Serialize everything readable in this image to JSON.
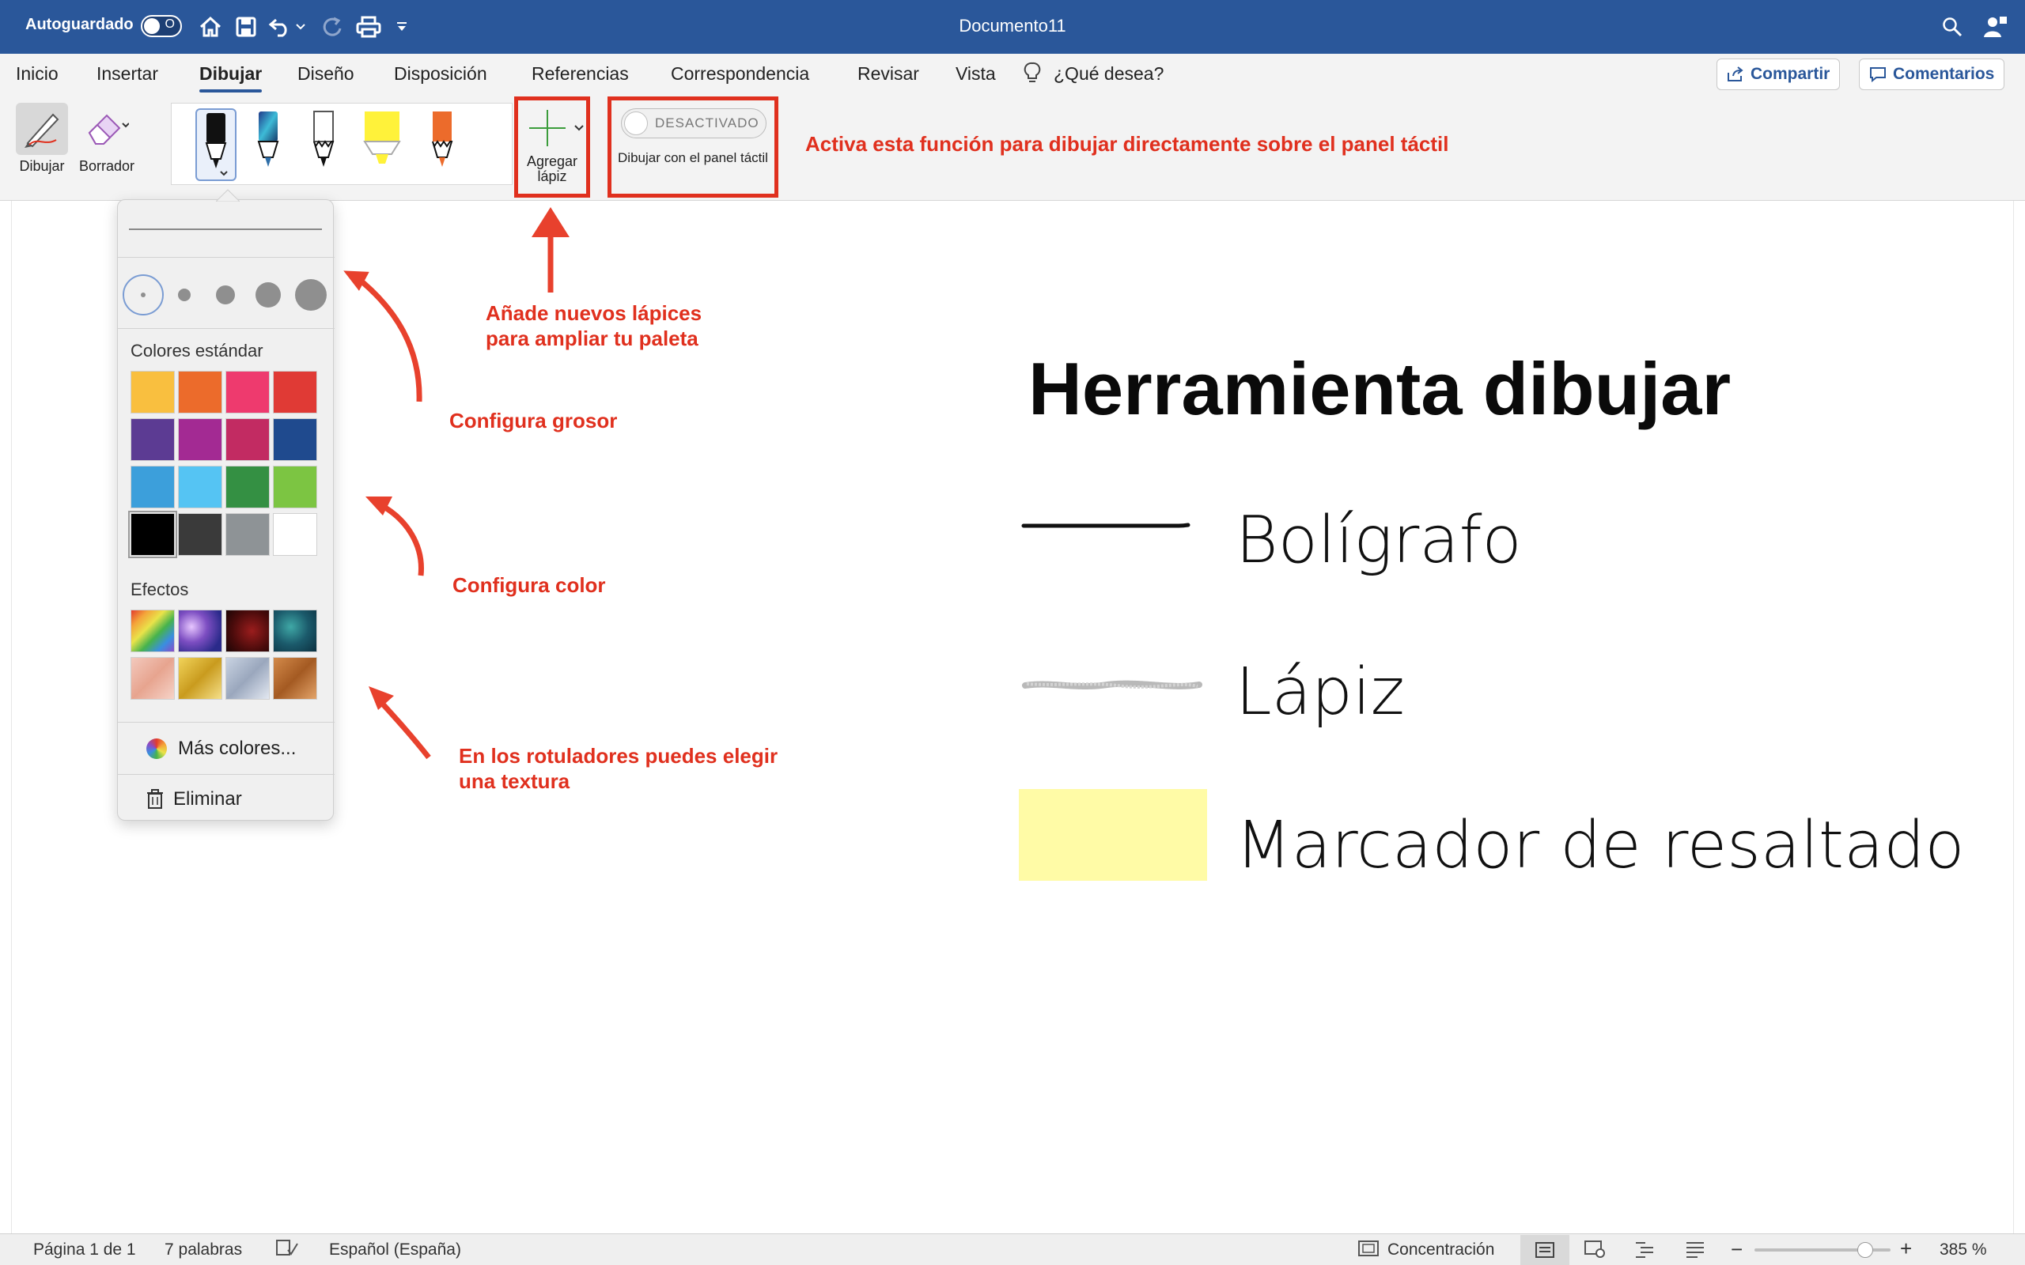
{
  "titlebar": {
    "autosave_label": "Autoguardado",
    "autosave_state": "O",
    "document_title": "Documento11"
  },
  "tabs": [
    {
      "label": "Inicio"
    },
    {
      "label": "Insertar"
    },
    {
      "label": "Dibujar",
      "active": true
    },
    {
      "label": "Diseño"
    },
    {
      "label": "Disposición"
    },
    {
      "label": "Referencias"
    },
    {
      "label": "Correspondencia"
    },
    {
      "label": "Revisar"
    },
    {
      "label": "Vista"
    },
    {
      "label": "¿Qué desea?"
    }
  ],
  "share_label": "Compartir",
  "comments_label": "Comentarios",
  "ribbon": {
    "draw_label": "Dibujar",
    "eraser_label": "Borrador",
    "add_pen_label": "Agregar lápiz",
    "trackpad_switch": "DESACTIVADO",
    "trackpad_label": "Dibujar con el panel táctil"
  },
  "annotations": {
    "trackpad": "Activa esta función para dibujar directamente sobre el panel táctil",
    "add_pen_line1": "Añade nuevos lápices",
    "add_pen_line2": "para ampliar tu paleta",
    "thickness": "Configura grosor",
    "color": "Configura color",
    "texture_line1": "En los rotuladores puedes elegir",
    "texture_line2": "una textura"
  },
  "palette": {
    "standard_colors_title": "Colores estándar",
    "standard_colors": [
      "#f9bf3f",
      "#ec6b2b",
      "#ee3a6e",
      "#e03a35",
      "#5c3b93",
      "#a32a93",
      "#c22b62",
      "#1f4a8e",
      "#3c9fdb",
      "#55c4f3",
      "#349043",
      "#7cc542",
      "#000000",
      "#3a3a3a",
      "#8e9396",
      "#ffffff"
    ],
    "effects_title": "Efectos",
    "effects": [
      "rainbow",
      "galaxy",
      "lava",
      "ocean",
      "rose-gold",
      "gold",
      "silver",
      "bronze"
    ],
    "more_colors": "Más colores...",
    "delete": "Eliminar"
  },
  "document": {
    "title": "Herramienta dibujar",
    "items": [
      {
        "label": "Bolígrafo",
        "style": "pen"
      },
      {
        "label": "Lápiz",
        "style": "pencil"
      },
      {
        "label": "Marcador de resaltado",
        "style": "highlighter",
        "color": "#fffba6"
      }
    ]
  },
  "status": {
    "page": "Página 1 de 1",
    "words": "7 palabras",
    "language": "Español (España)",
    "focus": "Concentración",
    "zoom": "385 %"
  },
  "colors": {
    "title_bar": "#2a579a",
    "annotation": "#e0301e"
  }
}
